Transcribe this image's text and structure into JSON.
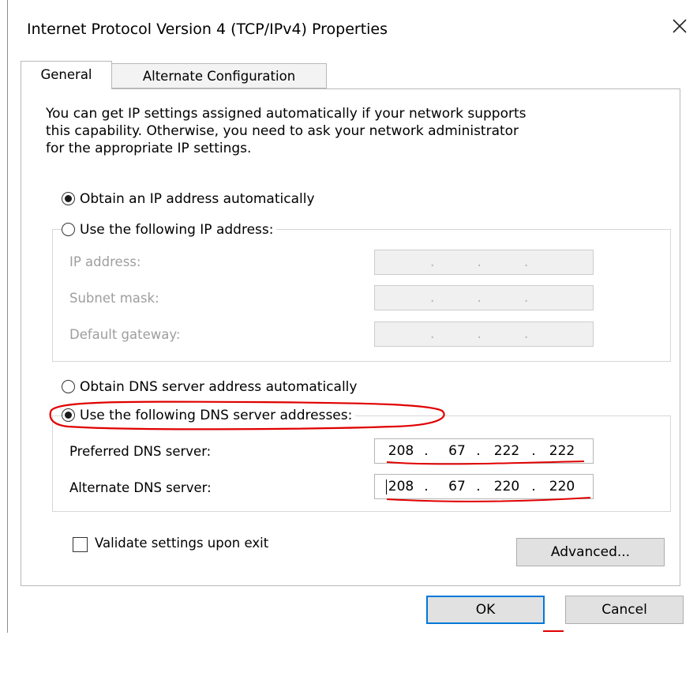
{
  "window": {
    "title": "Internet Protocol Version 4 (TCP/IPv4) Properties",
    "close_glyph": "✕"
  },
  "tabs": [
    {
      "label": "General",
      "active": true
    },
    {
      "label": "Alternate Configuration",
      "active": false
    }
  ],
  "description": [
    "You can get IP settings assigned automatically if your network supports",
    "this capability. Otherwise, you need to ask your network administrator",
    "for the appropriate IP settings."
  ],
  "ip_section": {
    "obtain_auto_label": "Obtain an IP address automatically",
    "obtain_auto_checked": true,
    "use_following_label": "Use the following IP address:",
    "use_following_checked": false,
    "fields": [
      {
        "label": "IP address:",
        "value": ".          .          ."
      },
      {
        "label": "Subnet mask:",
        "value": ".          .          ."
      },
      {
        "label": "Default gateway:",
        "value": ".          .          ."
      }
    ]
  },
  "dns_section": {
    "obtain_auto_label": "Obtain DNS server address automatically",
    "obtain_auto_checked": false,
    "use_following_label": "Use the following DNS server addresses:",
    "use_following_checked": true,
    "preferred": {
      "label": "Preferred DNS server:",
      "octets": [
        "208",
        "67",
        "222",
        "222"
      ]
    },
    "alternate": {
      "label": "Alternate DNS server:",
      "octets": [
        "208",
        "67",
        "220",
        "220"
      ]
    },
    "dot": "."
  },
  "validate": {
    "label": "Validate settings upon exit",
    "checked": false
  },
  "buttons": {
    "advanced": "Advanced...",
    "ok": "OK",
    "cancel": "Cancel"
  },
  "colors": {
    "annotation": "#e00000",
    "focus": "#0078d7"
  }
}
